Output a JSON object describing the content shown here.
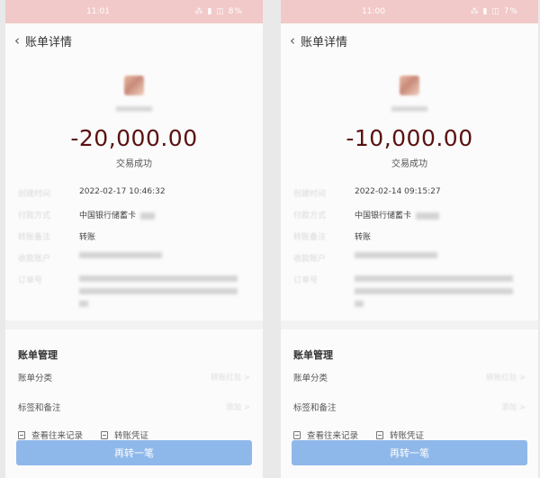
{
  "screens": [
    {
      "status_time": "11:01",
      "status_icons": "⁂ ▮ ◫ 8%",
      "nav_title": "账单详情",
      "amount": "-20,000.00",
      "status": "交易成功",
      "details": [
        {
          "label": "创建时间",
          "value": "2022-02-17 10:46:32"
        },
        {
          "label": "付款方式",
          "value": "中国银行储蓄卡"
        },
        {
          "label": "转账备注",
          "value": "转账"
        },
        {
          "label": "收款账户",
          "value": ""
        },
        {
          "label": "订单号",
          "value": ""
        }
      ],
      "manage_title": "账单管理",
      "manage_rows": [
        {
          "label": "账单分类",
          "value": "转账红包 >"
        },
        {
          "label": "标签和备注",
          "value": "添加 >"
        }
      ],
      "actions": [
        "查看往来记录",
        "转账凭证"
      ],
      "button_label": "再转一笔"
    },
    {
      "status_time": "11:00",
      "status_icons": "⁂ ▮ ◫ 7%",
      "nav_title": "账单详情",
      "amount": "-10,000.00",
      "status": "交易成功",
      "details": [
        {
          "label": "创建时间",
          "value": "2022-02-14 09:15:27"
        },
        {
          "label": "付款方式",
          "value": "中国银行储蓄卡"
        },
        {
          "label": "转账备注",
          "value": "转账"
        },
        {
          "label": "收款账户",
          "value": ""
        },
        {
          "label": "订单号",
          "value": ""
        }
      ],
      "manage_title": "账单管理",
      "manage_rows": [
        {
          "label": "账单分类",
          "value": "转账红包 >"
        },
        {
          "label": "标签和备注",
          "value": "添加 >"
        }
      ],
      "actions": [
        "查看往来记录",
        "转账凭证"
      ],
      "button_label": "再转一笔"
    }
  ]
}
